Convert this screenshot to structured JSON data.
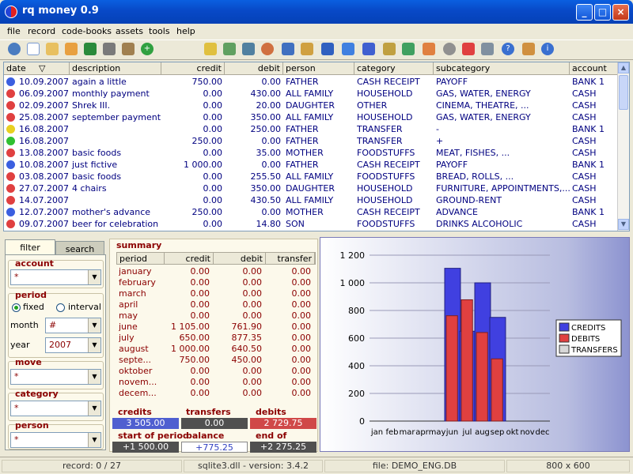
{
  "window": {
    "title": "rq money 0.9"
  },
  "menu": [
    "file",
    "record",
    "code-books",
    "assets",
    "tools",
    "help"
  ],
  "grid": {
    "headers": [
      "date",
      "description",
      "credit",
      "debit",
      "person",
      "category",
      "subcategory",
      "account"
    ],
    "rows": [
      {
        "status": "blue",
        "date": "10.09.2007",
        "description": "again a little",
        "credit": "750.00",
        "debit": "0.00",
        "person": "FATHER",
        "category": "CASH RECEIPT",
        "subcategory": "PAYOFF",
        "account": "BANK 1"
      },
      {
        "status": "red",
        "date": "06.09.2007",
        "description": "monthly payment",
        "credit": "0.00",
        "debit": "430.00",
        "person": "ALL FAMILY",
        "category": "HOUSEHOLD",
        "subcategory": "GAS, WATER, ENERGY",
        "account": "CASH"
      },
      {
        "status": "red",
        "date": "02.09.2007",
        "description": "Shrek III.",
        "credit": "0.00",
        "debit": "20.00",
        "person": "DAUGHTER",
        "category": "OTHER",
        "subcategory": "CINEMA, THEATRE, ...",
        "account": "CASH"
      },
      {
        "status": "red",
        "date": "25.08.2007",
        "description": "september payment",
        "credit": "0.00",
        "debit": "350.00",
        "person": "ALL FAMILY",
        "category": "HOUSEHOLD",
        "subcategory": "GAS, WATER, ENERGY",
        "account": "CASH"
      },
      {
        "status": "yellow",
        "date": "16.08.2007",
        "description": "",
        "credit": "0.00",
        "debit": "250.00",
        "person": "FATHER",
        "category": "TRANSFER",
        "subcategory": "-",
        "account": "BANK 1"
      },
      {
        "status": "green",
        "date": "16.08.2007",
        "description": "",
        "credit": "250.00",
        "debit": "0.00",
        "person": "FATHER",
        "category": "TRANSFER",
        "subcategory": "+",
        "account": "CASH"
      },
      {
        "status": "red",
        "date": "13.08.2007",
        "description": "basic foods",
        "credit": "0.00",
        "debit": "35.00",
        "person": "MOTHER",
        "category": "FOODSTUFFS",
        "subcategory": "MEAT, FISHES, ...",
        "account": "CASH"
      },
      {
        "status": "blue",
        "date": "10.08.2007",
        "description": "just fictive",
        "credit": "1 000.00",
        "debit": "0.00",
        "person": "FATHER",
        "category": "CASH RECEIPT",
        "subcategory": "PAYOFF",
        "account": "BANK 1"
      },
      {
        "status": "red",
        "date": "03.08.2007",
        "description": "basic foods",
        "credit": "0.00",
        "debit": "255.50",
        "person": "ALL FAMILY",
        "category": "FOODSTUFFS",
        "subcategory": "BREAD, ROLLS, ...",
        "account": "CASH"
      },
      {
        "status": "red",
        "date": "27.07.2007",
        "description": "4 chairs",
        "credit": "0.00",
        "debit": "350.00",
        "person": "DAUGHTER",
        "category": "HOUSEHOLD",
        "subcategory": "FURNITURE, APPOINTMENTS,...",
        "account": "CASH"
      },
      {
        "status": "red",
        "date": "14.07.2007",
        "description": "",
        "credit": "0.00",
        "debit": "430.50",
        "person": "ALL FAMILY",
        "category": "HOUSEHOLD",
        "subcategory": "GROUND-RENT",
        "account": "CASH"
      },
      {
        "status": "blue",
        "date": "12.07.2007",
        "description": "mother's advance",
        "credit": "250.00",
        "debit": "0.00",
        "person": "MOTHER",
        "category": "CASH RECEIPT",
        "subcategory": "ADVANCE",
        "account": "BANK 1"
      },
      {
        "status": "red",
        "date": "09.07.2007",
        "description": "beer for celebration",
        "credit": "0.00",
        "debit": "14.80",
        "person": "SON",
        "category": "FOODSTUFFS",
        "subcategory": "DRINKS ALCOHOLIC",
        "account": "CASH"
      }
    ]
  },
  "filter": {
    "tabs": {
      "filter": "filter",
      "search": "search"
    },
    "account_label": "account",
    "account_value": "*",
    "period_label": "period",
    "fixed_label": "fixed",
    "interval_label": "interval",
    "month_label": "month",
    "month_value": "#",
    "year_label": "year",
    "year_value": "2007",
    "move_label": "move",
    "move_value": "*",
    "category_label": "category",
    "category_value": "*",
    "person_label": "person",
    "person_value": "*"
  },
  "summary": {
    "title": "summary",
    "headers": [
      "period",
      "credit",
      "debit",
      "transfer"
    ],
    "rows": [
      [
        "january",
        "0.00",
        "0.00",
        "0.00"
      ],
      [
        "february",
        "0.00",
        "0.00",
        "0.00"
      ],
      [
        "march",
        "0.00",
        "0.00",
        "0.00"
      ],
      [
        "april",
        "0.00",
        "0.00",
        "0.00"
      ],
      [
        "may",
        "0.00",
        "0.00",
        "0.00"
      ],
      [
        "june",
        "1 105.00",
        "761.90",
        "0.00"
      ],
      [
        "july",
        "650.00",
        "877.35",
        "0.00"
      ],
      [
        "august",
        "1 000.00",
        "640.50",
        "0.00"
      ],
      [
        "septe...",
        "750.00",
        "450.00",
        "0.00"
      ],
      [
        "oktober",
        "0.00",
        "0.00",
        "0.00"
      ],
      [
        "novem...",
        "0.00",
        "0.00",
        "0.00"
      ],
      [
        "decem...",
        "0.00",
        "0.00",
        "0.00"
      ]
    ],
    "totals": {
      "credits_label": "credits",
      "credits": "3 505.00",
      "transfers_label": "transfers",
      "transfers": "0.00",
      "debits_label": "debits",
      "debits": "2 729.75",
      "start_label": "start of period",
      "start": "+1 500.00",
      "balance_label": "balance",
      "balance": "+775.25",
      "end_label": "end of period",
      "end": "+2 275.25"
    }
  },
  "chart_data": {
    "type": "bar",
    "categories": [
      "jan",
      "feb",
      "mar",
      "apr",
      "may",
      "jun",
      "jul",
      "aug",
      "sep",
      "okt",
      "nov",
      "dec"
    ],
    "series": [
      {
        "name": "CREDITS",
        "color": "#4040e0",
        "values": [
          0,
          0,
          0,
          0,
          0,
          1105,
          650,
          1000,
          750,
          0,
          0,
          0
        ]
      },
      {
        "name": "DEBITS",
        "color": "#e04040",
        "values": [
          0,
          0,
          0,
          0,
          0,
          761.9,
          877.35,
          640.5,
          450,
          0,
          0,
          0
        ]
      },
      {
        "name": "TRANSFERS",
        "color": "#d8d8d8",
        "values": [
          0,
          0,
          0,
          0,
          0,
          0,
          0,
          0,
          0,
          0,
          0,
          0
        ]
      }
    ],
    "ylim": [
      0,
      1200
    ],
    "yticks": [
      "0",
      "200",
      "400",
      "600",
      "800",
      "1 000",
      "1 200"
    ],
    "grid": true,
    "legend": "right"
  },
  "status": {
    "record": "record: 0 / 27",
    "sqlite": "sqlite3.dll - version: 3.4.2",
    "file": "file: DEMO_ENG.DB",
    "resolution": "800 x 600"
  },
  "colors": {
    "blue": "#3b5fe0",
    "red": "#e04040",
    "yellow": "#e8d020",
    "green": "#30c030"
  }
}
